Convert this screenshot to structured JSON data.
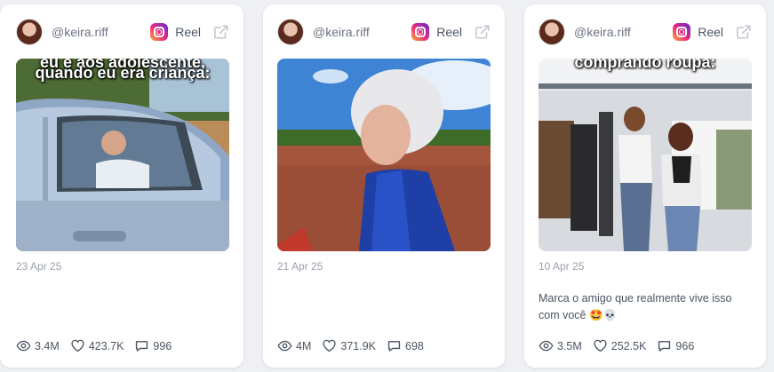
{
  "cards": [
    {
      "handle": "@keira.riff",
      "type_label": "Reel",
      "thumb_caption_top": "eu e aos adolescente,",
      "thumb_caption": "quando eu era criança:",
      "date": "23 Apr 25",
      "caption": "",
      "views": "3.4M",
      "likes": "423.7K",
      "comments": "996"
    },
    {
      "handle": "@keira.riff",
      "type_label": "Reel",
      "date": "21 Apr 25",
      "caption": "",
      "views": "4M",
      "likes": "371.9K",
      "comments": "698"
    },
    {
      "handle": "@keira.riff",
      "type_label": "Reel",
      "thumb_caption": "comprando roupa:",
      "date": "10 Apr 25",
      "caption": "Marca o amigo que realmente vive isso com você 🤩💀",
      "views": "3.5M",
      "likes": "252.5K",
      "comments": "966"
    }
  ],
  "icons": {
    "platform": "instagram-icon",
    "open": "external-link-icon",
    "views": "eye-icon",
    "likes": "heart-icon",
    "comments": "comment-icon"
  },
  "colors": {
    "page_bg": "#eef0f4",
    "card_bg": "#ffffff",
    "muted_text": "#9aa1ad",
    "body_text": "#4b5563"
  }
}
